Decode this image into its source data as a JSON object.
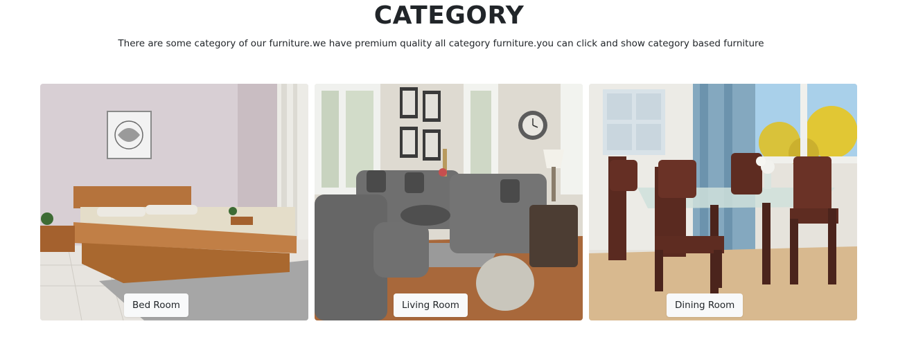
{
  "section": {
    "title": "CATEGORY",
    "description": "There are some category of our furniture.we have premium quality all category furniture.you can click and show category based furniture"
  },
  "categories": [
    {
      "label": "Bed Room",
      "image": "bedroom-photo"
    },
    {
      "label": "Living Room",
      "image": "living-room-photo"
    },
    {
      "label": "Dining Room",
      "image": "dining-room-photo"
    }
  ]
}
